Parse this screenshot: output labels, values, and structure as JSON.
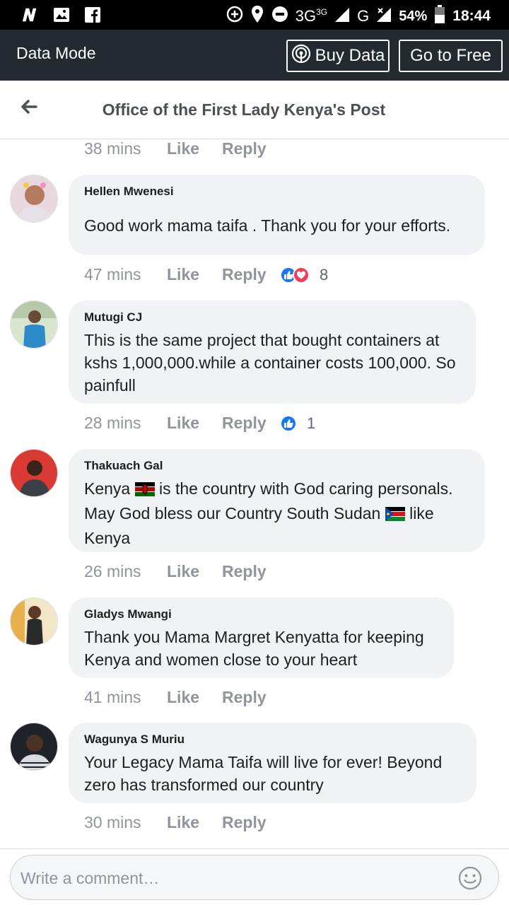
{
  "status_bar": {
    "network": "3G",
    "network_sup": "3G",
    "network2": "G",
    "battery": "54%",
    "time": "18:44"
  },
  "data_bar": {
    "label": "Data Mode",
    "buy_data": "Buy Data",
    "go_free": "Go to Free"
  },
  "header": {
    "title": "Office of the First Lady Kenya's Post"
  },
  "labels": {
    "like": "Like",
    "reply": "Reply"
  },
  "top_meta": {
    "time": "38 mins"
  },
  "comments": [
    {
      "author": "Hellen Mwenesi",
      "text": "Good work mama taifa . Thank you for your efforts.",
      "time": "47 mins",
      "reactions": [
        "like",
        "love"
      ],
      "reaction_count": "8"
    },
    {
      "author": "Mutugi CJ",
      "text": "This is the same project that bought containers at kshs 1,000,000.while a container costs 100,000. So painfull",
      "time": "28 mins",
      "reactions": [
        "like"
      ],
      "reaction_count": "1"
    },
    {
      "author": "Thakuach Gal",
      "text_part1": "Kenya",
      "text_part2": " is the country with God caring personals. May God bless our Country South Sudan",
      "text_part3": " like Kenya",
      "time": "26 mins"
    },
    {
      "author": "Gladys Mwangi",
      "text": "Thank you Mama Margret Kenyatta for keeping Kenya and women close to your heart",
      "time": "41 mins"
    },
    {
      "author": "Wagunya S Muriu",
      "text": "Your Legacy Mama Taifa will live for ever! Beyond zero has transformed our country",
      "time": "30 mins"
    }
  ],
  "composer": {
    "placeholder": "Write a comment…"
  },
  "colors": {
    "status_bar": "#000000",
    "data_bar": "#232a31",
    "bubble": "#f0f2f5",
    "meta_text": "#90949c",
    "like_blue": "#1877f2",
    "love_red": "#f33e58"
  }
}
